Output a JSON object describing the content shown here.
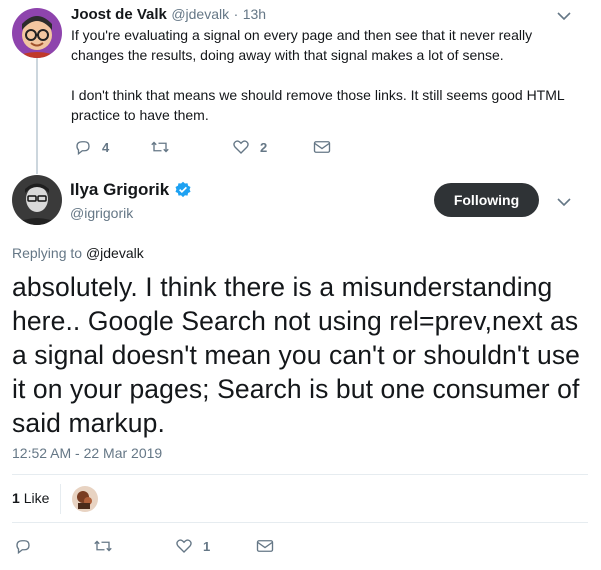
{
  "parent_tweet": {
    "author_name": "Joost de Valk",
    "author_handle": "@jdevalk",
    "separator": "·",
    "time": "13h",
    "paragraph_1": "If you're evaluating a signal on every page and then see that it never really changes the results, doing away with that signal makes a lot of sense.",
    "paragraph_2": "I don't think that means we should remove those links. It still seems good HTML practice to have them.",
    "reply_count": "4",
    "retweet_count": "",
    "like_count": "2"
  },
  "main_tweet": {
    "author_name": "Ilya Grigorik",
    "author_handle": "@igrigorik",
    "follow_label": "Following",
    "replying_prefix": "Replying to",
    "replying_handle": "@jdevalk",
    "text": "absolutely. I think there is a misunderstanding here.. Google Search not using rel=prev,next as a signal doesn't mean you can't or shouldn't use it on your pages; Search is but one consumer of said markup.",
    "timestamp": "12:52 AM - 22 Mar 2019",
    "likes_count": "1",
    "likes_word": "Like",
    "reply_count": "",
    "retweet_count": "",
    "like_count": "1"
  },
  "colors": {
    "text": "#14171a",
    "muted": "#657786",
    "divider": "#e6ecf0",
    "verified": "#1da1f2",
    "button": "#2f3336"
  },
  "icons": [
    "caret-down-icon",
    "reply-icon",
    "retweet-icon",
    "like-icon",
    "direct-message-icon",
    "verified-badge-icon"
  ]
}
